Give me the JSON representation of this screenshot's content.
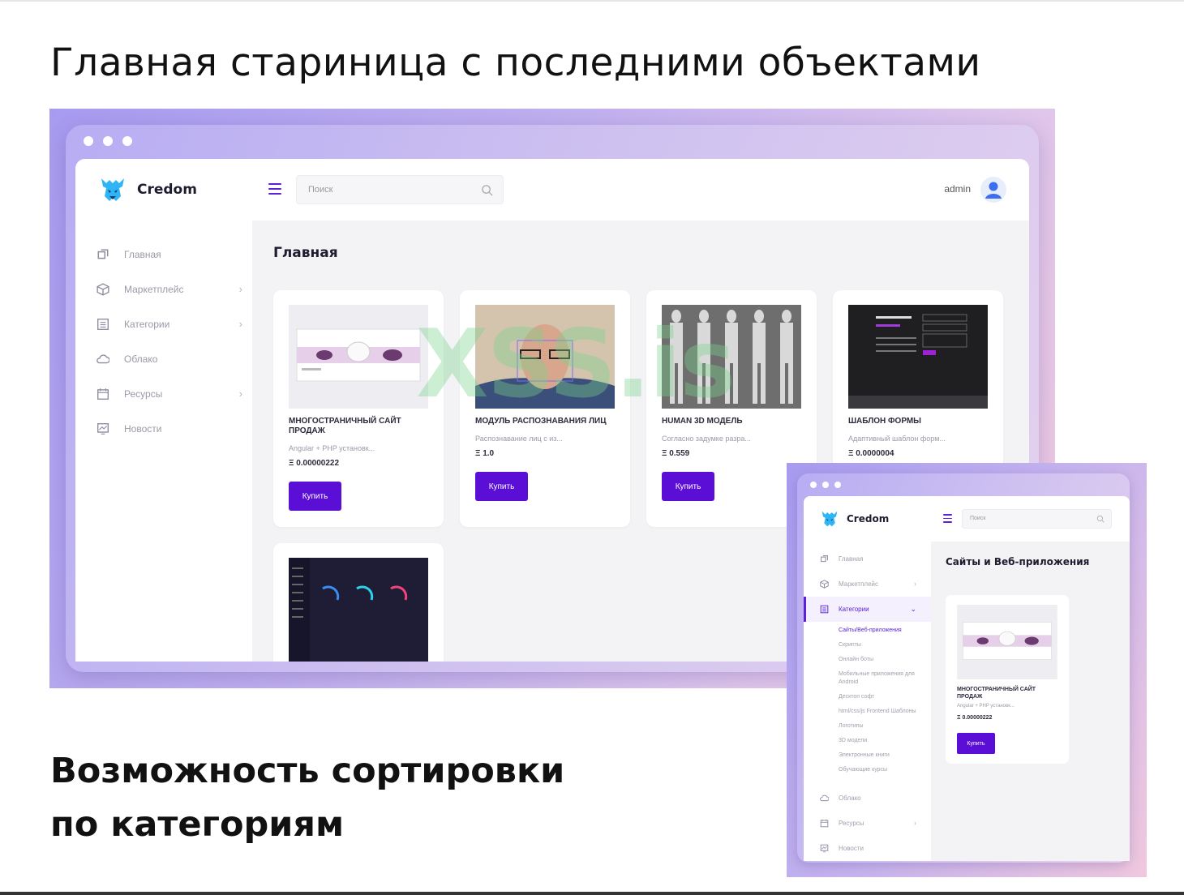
{
  "slide": {
    "heading_main": "Главная стариница с последними объектами",
    "heading_sort_line1": "Возможность сортировки",
    "heading_sort_line2": "по категориям"
  },
  "app": {
    "brand": "Credom",
    "search_placeholder": "Поиск",
    "user": "admin",
    "accent_color": "#5b0fd6"
  },
  "main_screen": {
    "sidebar": [
      {
        "label": "Главная",
        "icon": "home-icon",
        "has_chevron": false
      },
      {
        "label": "Маркетплейс",
        "icon": "cube-icon",
        "has_chevron": true
      },
      {
        "label": "Категории",
        "icon": "list-icon",
        "has_chevron": true
      },
      {
        "label": "Облако",
        "icon": "cloud-icon",
        "has_chevron": false
      },
      {
        "label": "Ресурсы",
        "icon": "calendar-icon",
        "has_chevron": true
      },
      {
        "label": "Новости",
        "icon": "news-icon",
        "has_chevron": false
      }
    ],
    "page_title": "Главная",
    "cards": [
      {
        "name": "МНОГОСТРАНИЧНЫЙ САЙТ ПРОДАЖ",
        "desc": "Angular + PHP установк...",
        "price": "Ξ 0.00000222",
        "buy": "Купить"
      },
      {
        "name": "МОДУЛЬ РАСПОЗНАВАНИЯ ЛИЦ",
        "desc": "Распознавание лиц с из...",
        "price": "Ξ 1.0",
        "buy": "Купить"
      },
      {
        "name": "HUMAN 3D МОДЕЛЬ",
        "desc": "Согласно задумке разра...",
        "price": "Ξ 0.559",
        "buy": "Купить"
      },
      {
        "name": "ШАБЛОН ФОРМЫ",
        "desc": "Адаптивный шаблон форм...",
        "price": "Ξ 0.0000004",
        "buy": "Купить"
      }
    ],
    "watermark": "XSS.is"
  },
  "category_screen": {
    "sidebar_top": [
      {
        "label": "Главная",
        "icon": "home-icon",
        "has_chevron": false
      },
      {
        "label": "Маркетплейс",
        "icon": "cube-icon",
        "has_chevron": true
      }
    ],
    "active_item": {
      "label": "Категории",
      "icon": "list-icon"
    },
    "subcategories": [
      {
        "label": "Сайты/Веб-приложения",
        "active": true
      },
      {
        "label": "Скрипты",
        "active": false
      },
      {
        "label": "Онлайн боты",
        "active": false
      },
      {
        "label": "Мобильные приложения для Android",
        "active": false
      },
      {
        "label": "Десктоп софт",
        "active": false
      },
      {
        "label": "html/css/js Frontend Шаблоны",
        "active": false
      },
      {
        "label": "Логотипы",
        "active": false
      },
      {
        "label": "3D модели",
        "active": false
      },
      {
        "label": "Электронные книги",
        "active": false
      },
      {
        "label": "Обучающие курсы",
        "active": false
      }
    ],
    "sidebar_bottom": [
      {
        "label": "Облако",
        "icon": "cloud-icon",
        "has_chevron": false
      },
      {
        "label": "Ресурсы",
        "icon": "calendar-icon",
        "has_chevron": true
      },
      {
        "label": "Новости",
        "icon": "news-icon",
        "has_chevron": false
      }
    ],
    "page_title": "Сайты и Веб-приложения",
    "card": {
      "name": "МНОГОСТРАНИЧНЫЙ САЙТ ПРОДАЖ",
      "desc": "Angular + PHP установк...",
      "price": "Ξ 0.00000222",
      "buy": "Купить"
    }
  }
}
